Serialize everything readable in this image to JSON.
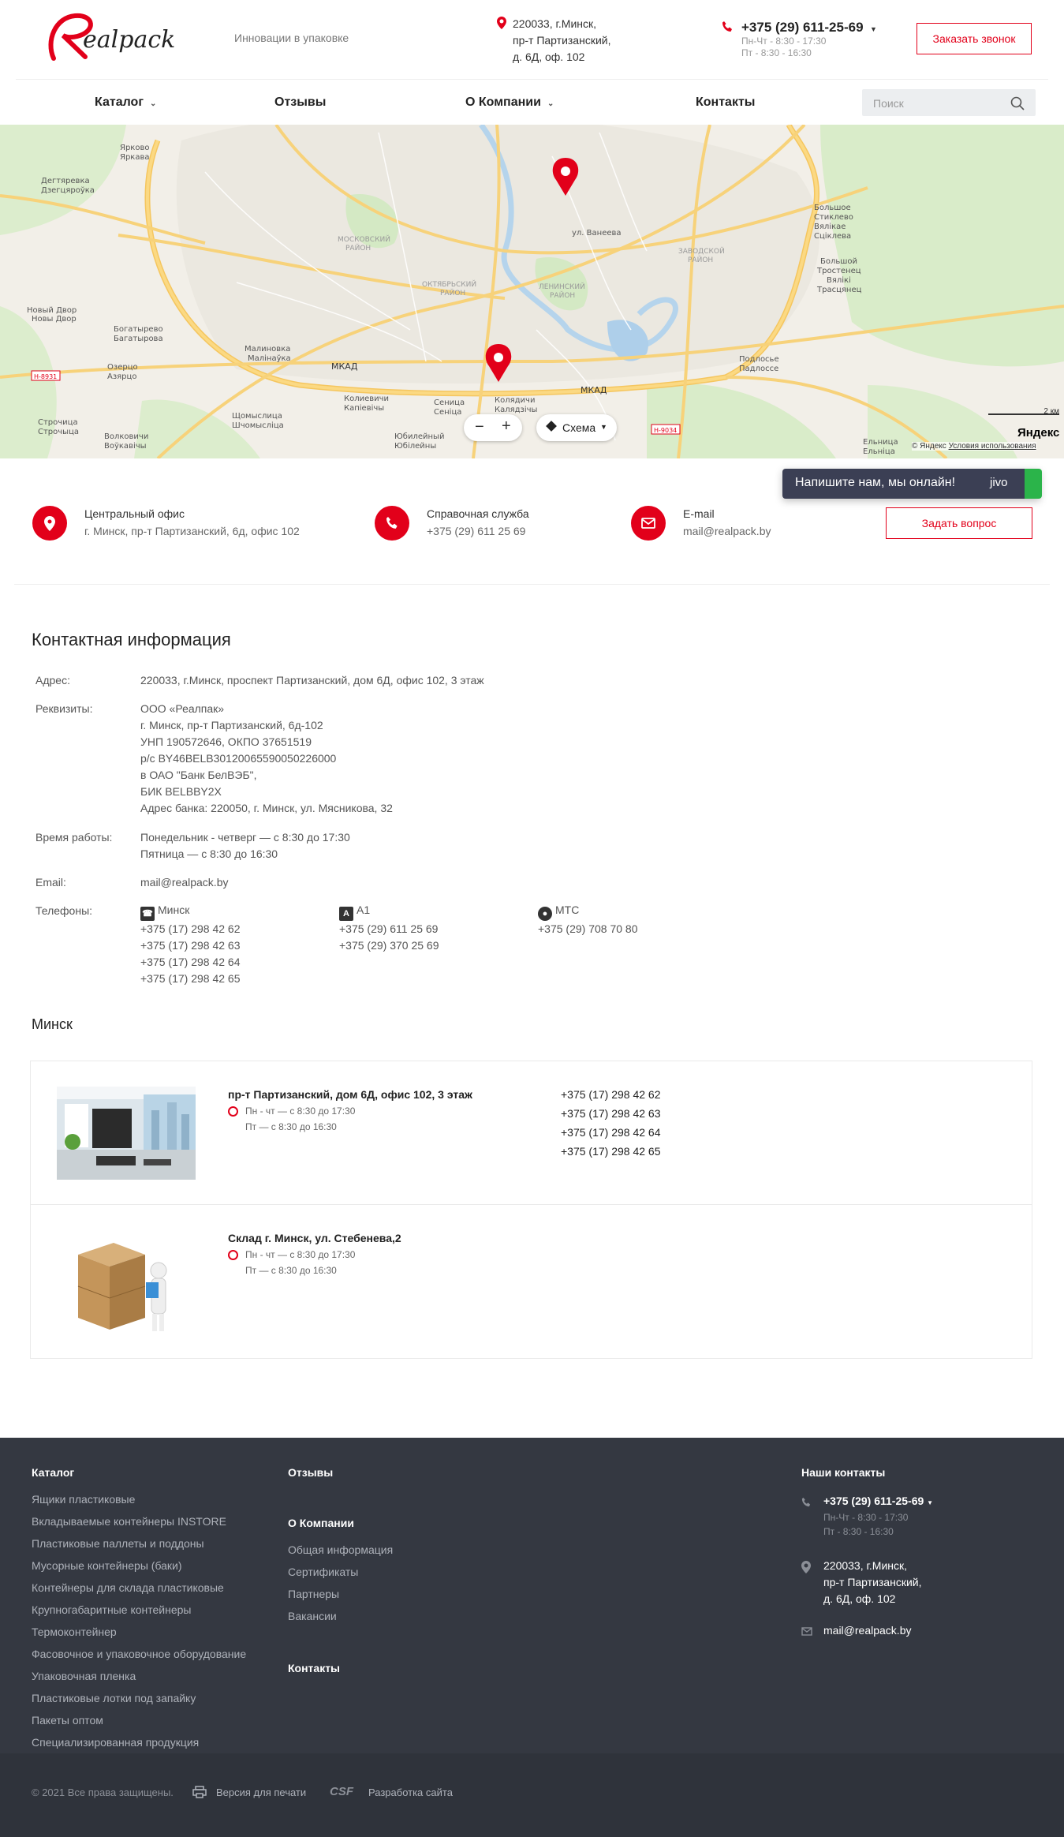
{
  "header": {
    "logo_text": "Realpack",
    "slogan": "Инновации в упаковке",
    "address": [
      "220033, г.Минск,",
      "пр-т Партизанский,",
      "д. 6Д, оф. 102"
    ],
    "phone": "+375 (29) 611-25-69",
    "hours": [
      "Пн-Чт - 8:30 - 17:30",
      "Пт - 8:30 - 16:30"
    ],
    "callback_label": "Заказать звонок"
  },
  "nav": {
    "items": [
      "Каталог",
      "Отзывы",
      "О Компании",
      "Контакты"
    ],
    "search_placeholder": "Поиск"
  },
  "map": {
    "labels": {
      "yarkovo": "Ярково\nЯркава",
      "degt": "Дегтяревка\nДзегцяроўка",
      "mkad": "МКАД",
      "moscow": "МОСКОВСКИЙ\nРАЙОН",
      "oktyabr": "ОКТЯБРЬСКИЙ\nРАЙОН",
      "lenin": "ЛЕНИНСКИЙ\nРАЙОН",
      "zavod": "ЗАВОДСКОЙ\nРАЙОН",
      "bogatyr": "Богатырево\nБагатырова",
      "novy": "Новый Двор\nНовы Двор",
      "ozertso": "Озерцо\nАзярцо",
      "malin": "Малиновка\nМалінаўка",
      "strochitsa": "Строчица\nСтрочыца",
      "volkov": "Волковичи\nВоўкавічы",
      "shchom": "Щомыслица\nШчомысліца",
      "koly": "Колиевичи\nКапіевічы",
      "senica": "Сеница\nСеніца",
      "kolyadichi": "Колядичи\nКалядзічы",
      "yubil": "Юбилейный\nЮбілейны",
      "bolsh": "Большое\nСтиклево\nВялікае\nСціклева",
      "bolsh2": "Большой\nТростенец\nВялікі\nТрасцянец",
      "podlos": "Подлосье\nПадлоссе",
      "elnica": "Ельница\nЕльніца",
      "novy2": "Новый Двор",
      "ul_vaneeva": "ул. Ванеева",
      "h8931": "Н-8931",
      "h9034": "Н-9034",
      "scale": "2 км",
      "copyright": "© Яндекс",
      "terms": "Условия использования",
      "yandex": "Яндекс"
    },
    "layer_label": "Схема"
  },
  "contacts_strip": {
    "office_title": "Центральный офис",
    "office_text": "г. Минск, пр-т Партизанский, 6д, офис 102",
    "help_title": "Справочная служба",
    "help_text": "+375 (29) 611 25 69",
    "email_title": "E-mail",
    "email_text": "mail@realpack.by",
    "ask_label": "Задать вопрос",
    "chat_text": "Напишите нам, мы онлайн!",
    "chat_brand": "jivo"
  },
  "info": {
    "title": "Контактная информация",
    "address_label": "Адрес:",
    "address": "220033, г.Минск, проспект Партизанский, дом 6Д, офис 102, 3 этаж",
    "req_label": "Реквизиты:",
    "req": [
      "ООО «Реалпак»",
      "г. Минск, пр-т Партизанский, 6д-102",
      "УНП 190572646, ОКПО 37651519",
      "р/с BY46BELB30120065590050226000",
      "в ОАО \"Банк БелВЭБ\",",
      "БИК BELBBY2X",
      "Адрес банка: 220050, г. Минск, ул. Мясникова, 32"
    ],
    "hours_label": "Время работы:",
    "hours": [
      "Понедельник - четверг — с 8:30 до 17:30",
      "Пятница — с 8:30 до 16:30"
    ],
    "email_label": "Email:",
    "email": "mail@realpack.by",
    "phones_label": "Телефоны:",
    "minsk_label": "Минск",
    "minsk": [
      "+375 (17) 298 42 62",
      "+375 (17) 298 42 63",
      "+375 (17) 298 42 64",
      "+375 (17) 298 42 65"
    ],
    "a1_label": "A1",
    "a1": [
      "+375 (29) 611 25 69",
      "+375 (29) 370 25 69"
    ],
    "mts_label": "МТС",
    "mts": [
      "+375 (29) 708 70 80"
    ]
  },
  "stores": {
    "city": "Минск",
    "s1_title": "пр-т Партизанский, дом 6Д, офис 102, 3 этаж",
    "s1_hours": [
      "Пн - чт — с 8:30 до 17:30",
      "Пт — с 8:30 до 16:30"
    ],
    "s1_phones": [
      "+375 (17) 298 42 62",
      "+375 (17) 298 42 63",
      "+375 (17) 298 42 64",
      "+375 (17) 298 42 65"
    ],
    "s2_title": "Склад г. Минск, ул. Стебенева,2",
    "s2_hours": [
      "Пн - чт — с 8:30 до 17:30",
      "Пт — с 8:30 до 16:30"
    ]
  },
  "footer": {
    "catalog_title": "Каталог",
    "catalog": [
      "Ящики пластиковые",
      "Вкладываемые контейнеры INSTORE",
      "Пластиковые паллеты и поддоны",
      "Мусорные контейнеры (баки)",
      "Контейнеры для склада пластиковые",
      "Крупногабаритные контейнеры",
      "Термоконтейнер",
      "Фасовочное и упаковочное оборудование",
      "Упаковочная пленка",
      "Пластиковые лотки под запайку",
      "Пакеты оптом",
      "Специализированная продукция"
    ],
    "reviews": "Отзывы",
    "company_title": "О Компании",
    "company": [
      "Общая информация",
      "Сертификаты",
      "Партнеры",
      "Вакансии"
    ],
    "contacts": "Контакты",
    "our_contacts": "Наши контакты",
    "phone": "+375 (29) 611-25-69",
    "hours": [
      "Пн-Чт - 8:30 - 17:30",
      "Пт - 8:30 - 16:30"
    ],
    "address": [
      "220033, г.Минск,",
      "пр-т Партизанский,",
      "д. 6Д, оф. 102"
    ],
    "email": "mail@realpack.by",
    "copyright": "© 2021 Все права защищены.",
    "print": "Версия для печати",
    "csf": "CSF",
    "dev": "Разработка сайта"
  }
}
